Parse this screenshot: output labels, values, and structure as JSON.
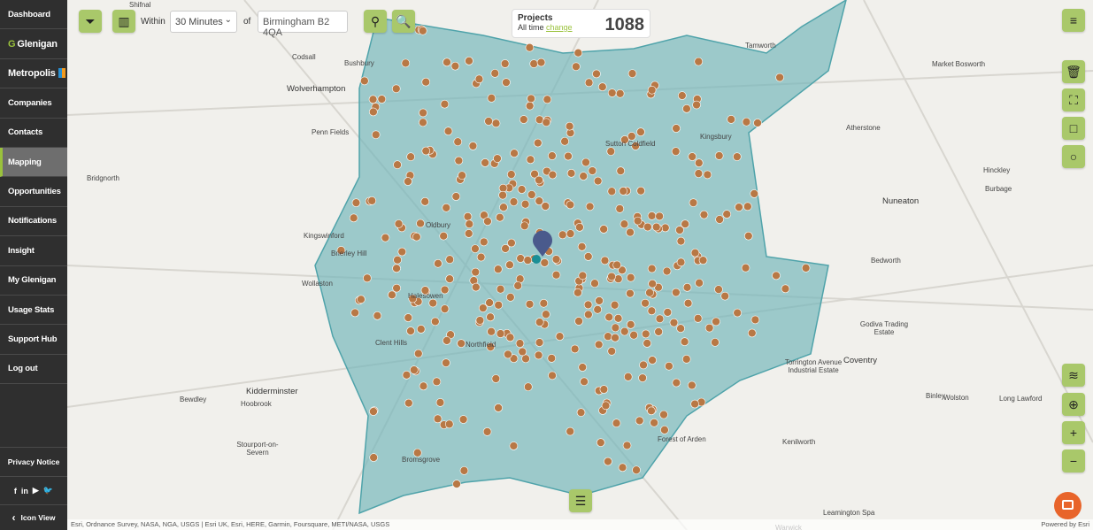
{
  "sidebar": {
    "items": [
      {
        "label": "Dashboard"
      },
      {
        "label": "Glenigan",
        "brand": true
      },
      {
        "label": "Metropolis",
        "brand": true
      },
      {
        "label": "Companies"
      },
      {
        "label": "Contacts"
      },
      {
        "label": "Mapping",
        "active": true
      },
      {
        "label": "Opportunities"
      },
      {
        "label": "Notifications"
      },
      {
        "label": "Insight"
      },
      {
        "label": "My Glenigan"
      },
      {
        "label": "Usage Stats"
      },
      {
        "label": "Support Hub"
      },
      {
        "label": "Log out"
      }
    ],
    "privacy": "Privacy Notice",
    "social_icons": [
      "facebook-icon",
      "linkedin-icon",
      "youtube-icon",
      "twitter-icon"
    ],
    "icon_view": "Icon View"
  },
  "toolbar": {
    "within_label": "Within",
    "time_value": "30 Minutes",
    "of_label": "of",
    "location_value": "Birmingham B2 4QA"
  },
  "projects": {
    "title": "Projects",
    "period": "All time",
    "change_link": "change",
    "count": "1088"
  },
  "colors": {
    "accent": "#a9c86a",
    "isochrone": "#6fb3b8",
    "marker": "#b87845",
    "chat": "#e8642a",
    "sidebar": "#2f2f2f"
  },
  "map_labels": [
    "Shifnal",
    "Codsall",
    "Bushbury",
    "Wolverhampton",
    "Penn Fields",
    "Bridgnorth",
    "Kingswinford",
    "Brierley Hill",
    "Wollaston",
    "Clent Hills",
    "Kidderminster",
    "Bewdley",
    "Hoobrook",
    "Stourport-on-Severn",
    "Bromsgrove",
    "Tamworth",
    "Market Bosworth",
    "Atherstone",
    "Kingsbury",
    "Hinckley",
    "Burbage",
    "Nuneaton",
    "Bedworth",
    "Coventry",
    "Godiva Trading Estate",
    "Torrington Avenue Industrial Estate",
    "Binley",
    "Wolston",
    "Long Lawford",
    "Kenilworth",
    "Forest of Arden",
    "Leamington Spa",
    "Warwick",
    "Sutton Coldfield",
    "Oldbury",
    "Halesowen",
    "Northfield"
  ],
  "attribution": "Esri, Ordnance Survey, NASA, NGA, USGS | Esri UK, Esri, HERE, Garmin, Foursquare, METI/NASA, USGS",
  "powered_by": "Powered by Esri"
}
